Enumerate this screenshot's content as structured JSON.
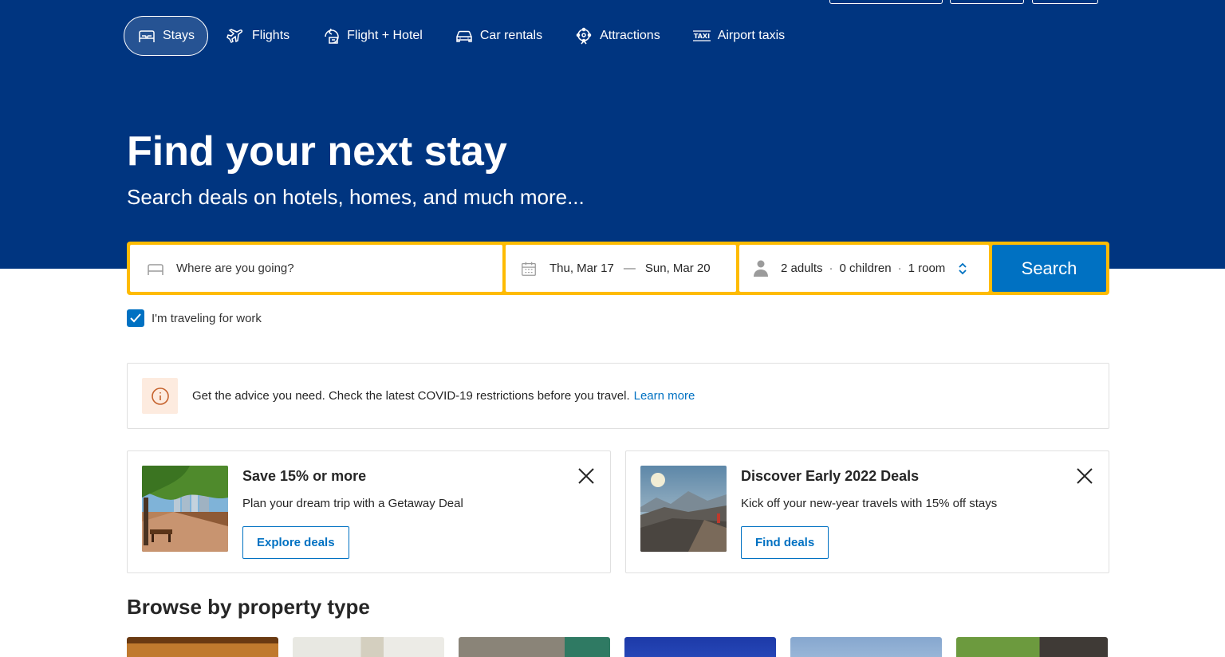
{
  "nav": {
    "items": [
      {
        "label": "Stays",
        "icon": "bed-icon",
        "active": true
      },
      {
        "label": "Flights",
        "icon": "plane-icon",
        "active": false
      },
      {
        "label": "Flight + Hotel",
        "icon": "flight-hotel-icon",
        "active": false
      },
      {
        "label": "Car rentals",
        "icon": "car-icon",
        "active": false
      },
      {
        "label": "Attractions",
        "icon": "attractions-icon",
        "active": false
      },
      {
        "label": "Airport taxis",
        "icon": "taxi-icon",
        "active": false
      }
    ]
  },
  "hero": {
    "title": "Find your next stay",
    "subtitle": "Search deals on hotels, homes, and much more..."
  },
  "search": {
    "destination_placeholder": "Where are you going?",
    "checkin": "Thu, Mar 17",
    "date_separator": "—",
    "checkout": "Sun, Mar 20",
    "adults": "2 adults",
    "children": "0 children",
    "rooms": "1 room",
    "guest_separator": "·",
    "button_label": "Search"
  },
  "work_travel": {
    "label": "I'm traveling for work",
    "checked": true
  },
  "covid": {
    "text": "Get the advice you need. Check the latest COVID-19 restrictions before you travel.",
    "link": "Learn more"
  },
  "promos": [
    {
      "title": "Save 15% or more",
      "text": "Plan your dream trip with a Getaway Deal",
      "button": "Explore deals"
    },
    {
      "title": "Discover Early 2022 Deals",
      "text": "Kick off your new-year travels with 15% off stays",
      "button": "Find deals"
    }
  ],
  "browse": {
    "title": "Browse by property type"
  },
  "colors": {
    "brand_blue": "#003580",
    "accent_yellow": "#febb02",
    "action_blue": "#0071c2"
  }
}
